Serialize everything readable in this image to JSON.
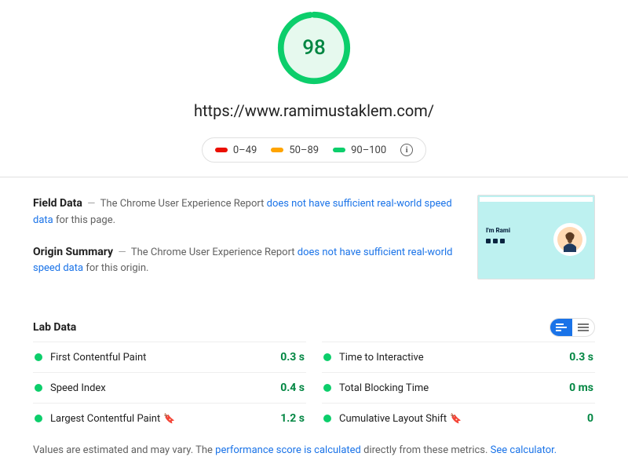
{
  "score": "98",
  "url": "https://www.ramimustaklem.com/",
  "legend": {
    "r1": "0–49",
    "r2": "50–89",
    "r3": "90–100"
  },
  "fieldData": {
    "label": "Field Data",
    "pre": "The Chrome User Experience Report ",
    "link": "does not have sufficient real-world speed data",
    "post": " for this page."
  },
  "originSummary": {
    "label": "Origin Summary",
    "pre": "The Chrome User Experience Report ",
    "link": "does not have sufficient real-world speed data",
    "post": " for this origin."
  },
  "thumbText": "I'm Rami",
  "labDataLabel": "Lab Data",
  "metricsLeft": [
    {
      "name": "First Contentful Paint",
      "value": "0.3 s",
      "bookmark": false
    },
    {
      "name": "Speed Index",
      "value": "0.4 s",
      "bookmark": false
    },
    {
      "name": "Largest Contentful Paint",
      "value": "1.2 s",
      "bookmark": true
    }
  ],
  "metricsRight": [
    {
      "name": "Time to Interactive",
      "value": "0.3 s",
      "bookmark": false
    },
    {
      "name": "Total Blocking Time",
      "value": "0 ms",
      "bookmark": false
    },
    {
      "name": "Cumulative Layout Shift",
      "value": "0",
      "bookmark": true
    }
  ],
  "footnote": {
    "pre": "Values are estimated and may vary. The ",
    "link1": "performance score is calculated",
    "mid": " directly from these metrics. ",
    "link2": "See calculator."
  }
}
